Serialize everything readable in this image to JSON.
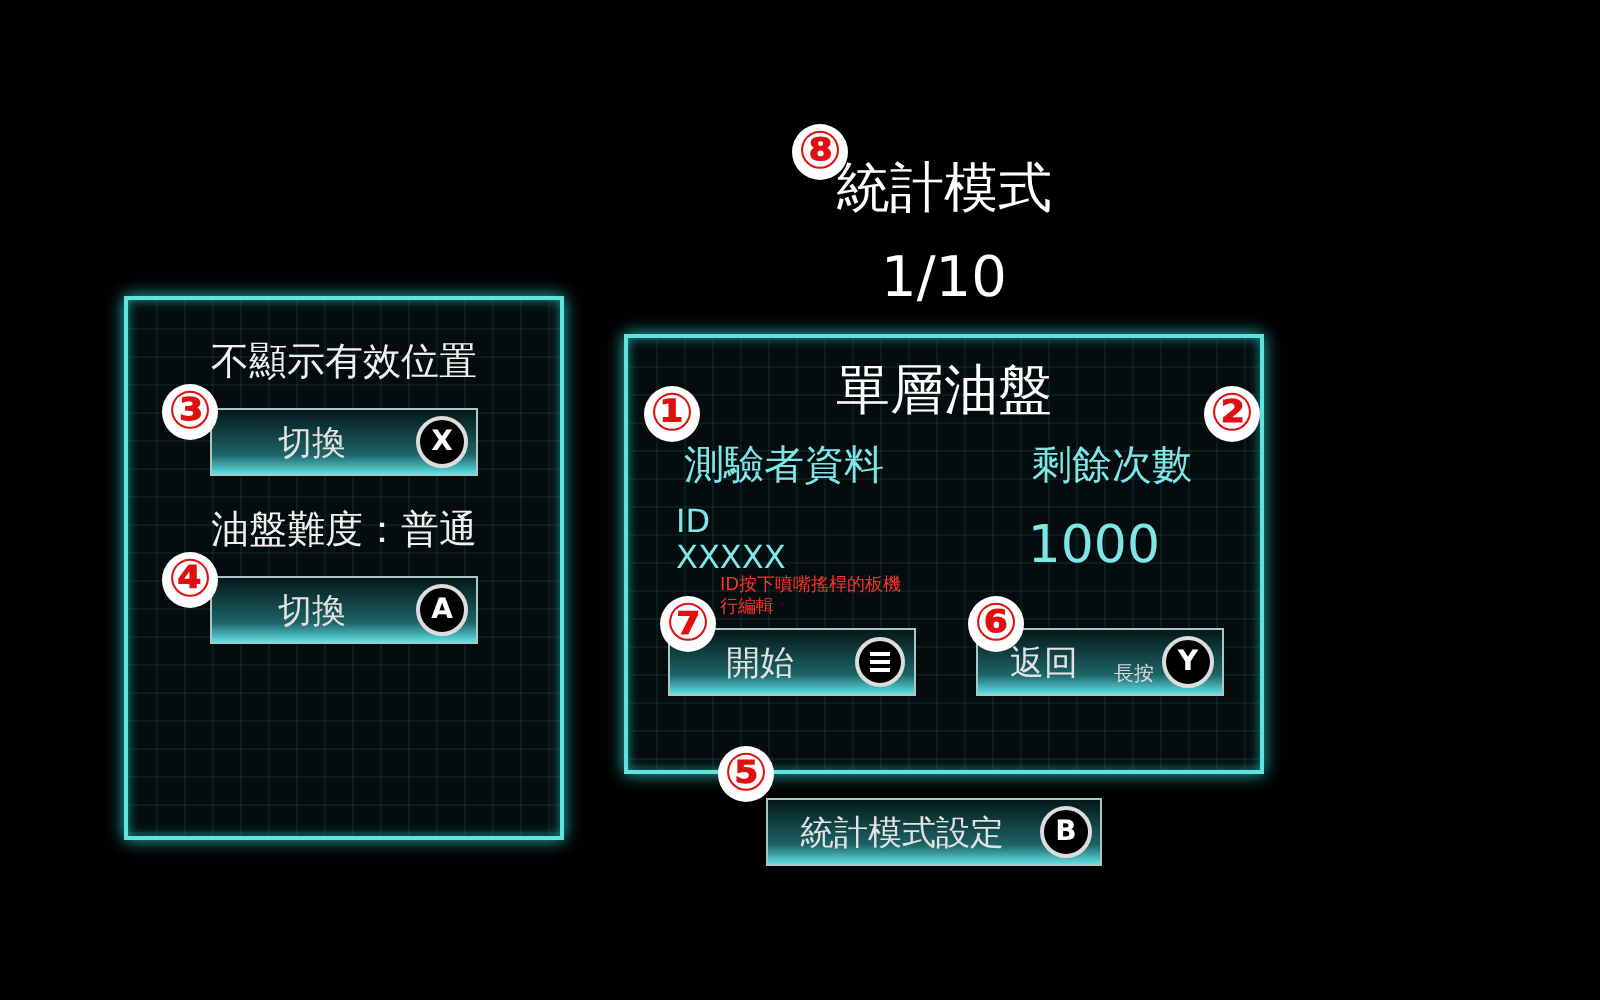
{
  "header": {
    "title": "統計模式",
    "badge": "⑧",
    "page": "1/10"
  },
  "left_panel": {
    "items": [
      {
        "label": "不顯示有效位置",
        "button": {
          "label": "切換",
          "key": "X",
          "badge": "③"
        }
      },
      {
        "label": "油盤難度：普通",
        "button": {
          "label": "切換",
          "key": "A",
          "badge": "④"
        }
      }
    ]
  },
  "main_panel": {
    "title": "單層油盤",
    "columns": [
      {
        "heading": "測驗者資料",
        "badge": "①"
      },
      {
        "heading": "剩餘次數",
        "badge": "②"
      }
    ],
    "id_label": "ID",
    "id_value": "XXXXX",
    "hint_lines": [
      "ID按下噴嘴搖桿的板機",
      "行編輯"
    ],
    "remaining": "1000",
    "buttons": [
      {
        "label": "開始",
        "kind": "menu",
        "badge": "⑦"
      },
      {
        "label": "返回",
        "kind": "letter",
        "key": "Y",
        "note": "長按",
        "badge": "⑥"
      }
    ]
  },
  "settings_button": {
    "label": "統計模式設定",
    "key": "B",
    "badge": "⑤"
  }
}
